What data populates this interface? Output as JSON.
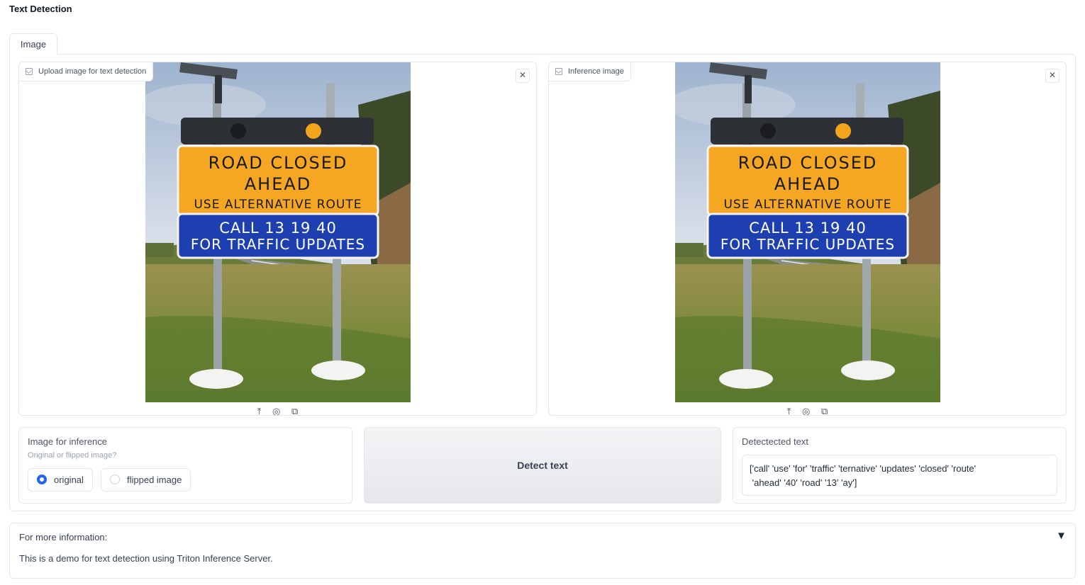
{
  "app": {
    "title": "Text Detection"
  },
  "tabs": [
    {
      "label": "Image"
    }
  ],
  "input_image": {
    "label": "Upload image for text detection",
    "label_icon": "image-icon",
    "close_icon": "close-icon"
  },
  "output_image": {
    "label": "Inference image",
    "label_icon": "image-icon",
    "close_icon": "close-icon"
  },
  "sign": {
    "line1": "ROAD CLOSED",
    "line2": "AHEAD",
    "line3": "USE ALTERNATIVE ROUTE",
    "line4": "CALL 13 19 40",
    "line5": "FOR TRAFFIC UPDATES"
  },
  "image_tools": {
    "upload_icon": "upload-icon",
    "webcam_icon": "webcam-icon",
    "clipboard_icon": "clipboard-icon",
    "upload_glyph": "⤒",
    "webcam_glyph": "◎",
    "clipboard_glyph": "⧉"
  },
  "inference_option": {
    "label": "Image for inference",
    "info": "Original or flipped image?",
    "options": [
      {
        "label": "original",
        "selected": true
      },
      {
        "label": "flipped image",
        "selected": false
      }
    ]
  },
  "detect_button": {
    "label": "Detect text"
  },
  "detected_text": {
    "label": "Detectected text",
    "value": "['call' 'use' 'for' 'traffic' 'ternative' 'updates' 'closed' 'route'\n 'ahead' '40' 'road' '13' 'ay']"
  },
  "accordion": {
    "title": "For more information:",
    "arrow": "▼",
    "body": "This is a demo for text detection using Triton Inference Server."
  },
  "colors": {
    "accent": "#2563eb",
    "sign_orange": "#f5a623",
    "sign_blue": "#1d3fb0"
  }
}
